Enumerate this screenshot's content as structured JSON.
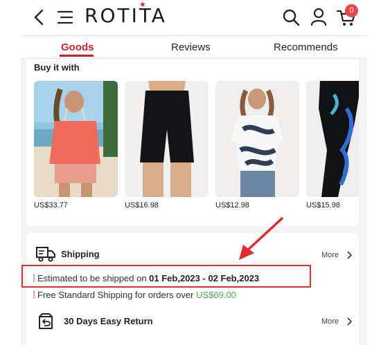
{
  "header": {
    "logo_text": "ROTITA",
    "cart_count": "0",
    "icons": [
      "back-icon",
      "menu-icon",
      "search-icon",
      "user-icon",
      "cart-icon"
    ],
    "accent_color": "#c8222b"
  },
  "tabs": [
    {
      "label": "Goods",
      "active": true
    },
    {
      "label": "Reviews",
      "active": false
    },
    {
      "label": "Recommends",
      "active": false
    }
  ],
  "buy_it_with": {
    "title": "Buy it with",
    "products": [
      {
        "price": "US$33.77"
      },
      {
        "price": "US$16.98"
      },
      {
        "price": "US$12.98"
      },
      {
        "price": "US$15.98"
      }
    ]
  },
  "shipping": {
    "title": "Shipping",
    "more_label": "More",
    "estimate_prefix": "Estimated to be shipped on ",
    "estimate_dates": "01 Feb,2023 - 02 Feb,2023",
    "free_prefix": "Free Standard Shipping for orders over ",
    "free_threshold": "US$69.00",
    "threshold_color": "#4caf50"
  },
  "returns": {
    "title": "30 Days Easy Return",
    "more_label": "More"
  },
  "annotation": {
    "color": "#e32b2b"
  }
}
